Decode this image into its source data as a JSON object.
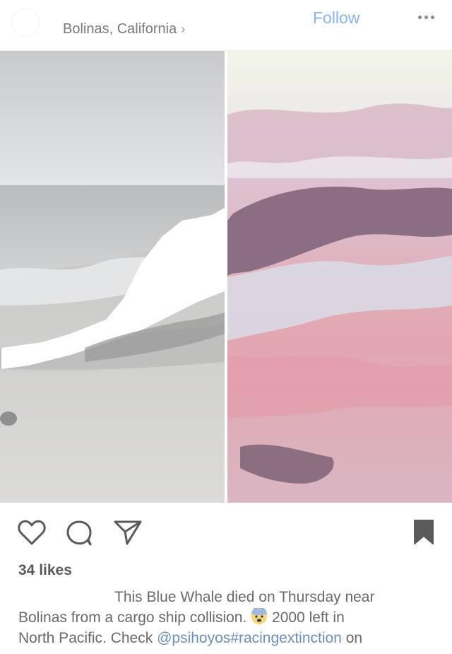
{
  "header": {
    "location": "Bolinas, California",
    "location_chevron": "›",
    "follow_label": "Follow",
    "more_icon": "ellipsis-icon"
  },
  "post": {
    "image_description_icons": [
      "heart-icon",
      "comment-icon",
      "share-icon",
      "bookmark-icon"
    ],
    "likes": "34 likes",
    "caption": {
      "line1": "This Blue Whale died on Thursday near",
      "line2_a": "Bolinas from a cargo ship collision.",
      "line2_b": "2000 left in",
      "line3_a": "North Pacific. Check",
      "mention": "@psihoyos#racingextinction",
      "line3_b": "on"
    }
  },
  "colors": {
    "follow": "#8cb4e8",
    "mention": "#6e8fb8",
    "likes": "#5a5a5a"
  }
}
